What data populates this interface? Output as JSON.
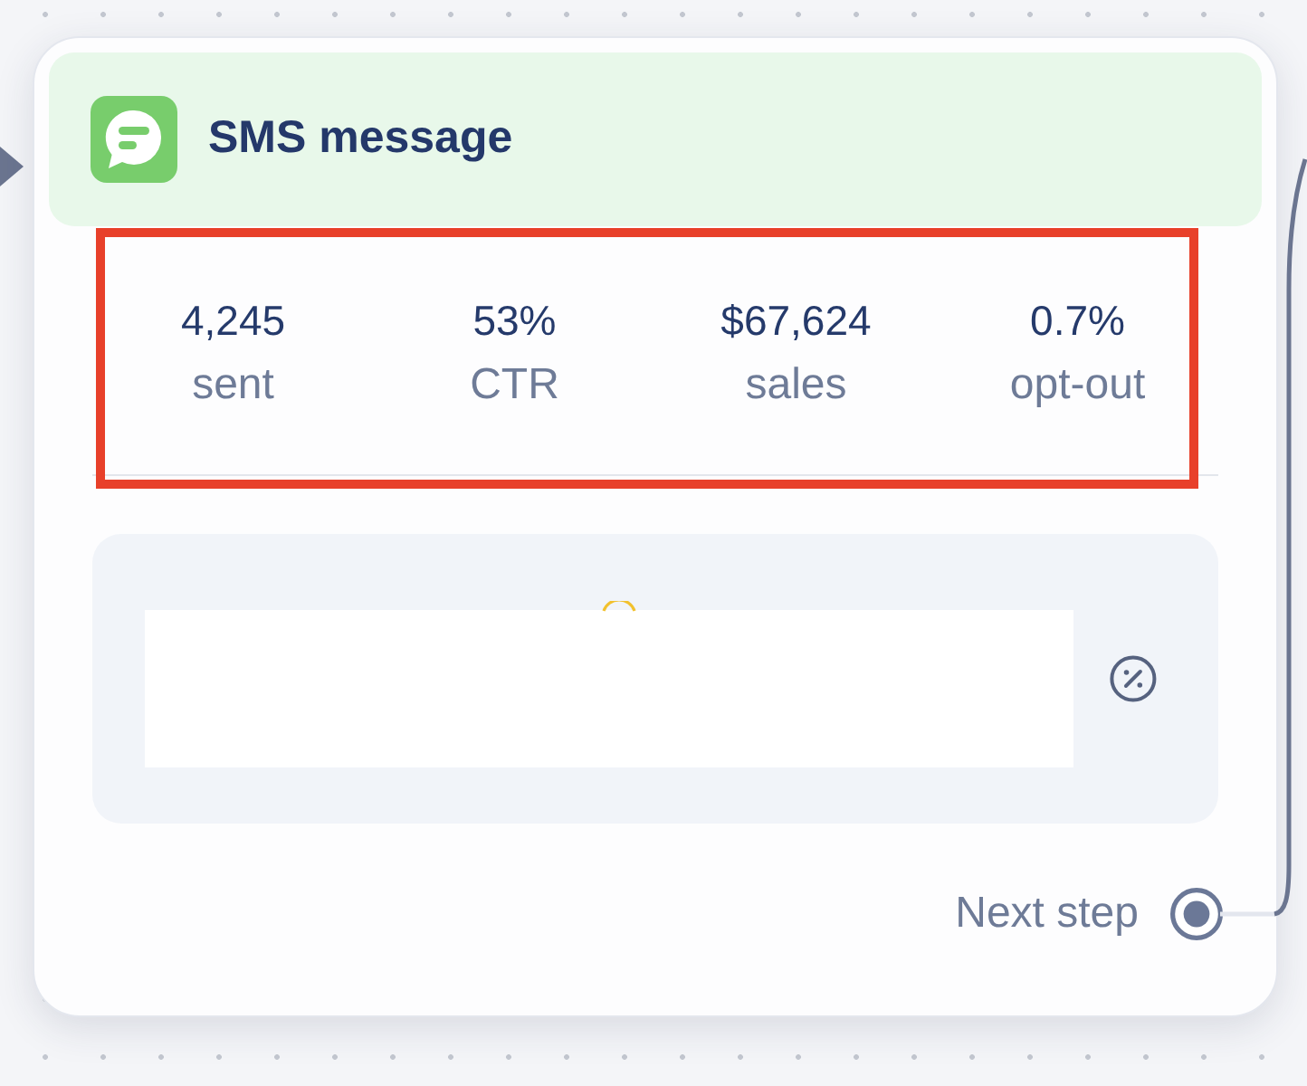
{
  "node": {
    "title": "SMS message",
    "stats_highlighted": true,
    "stats": [
      {
        "value": "4,245",
        "label": "sent"
      },
      {
        "value": "53%",
        "label": "CTR"
      },
      {
        "value": "$67,624",
        "label": "sales"
      },
      {
        "value": "0.7%",
        "label": "opt-out"
      }
    ],
    "output": {
      "label": "Next step"
    }
  }
}
